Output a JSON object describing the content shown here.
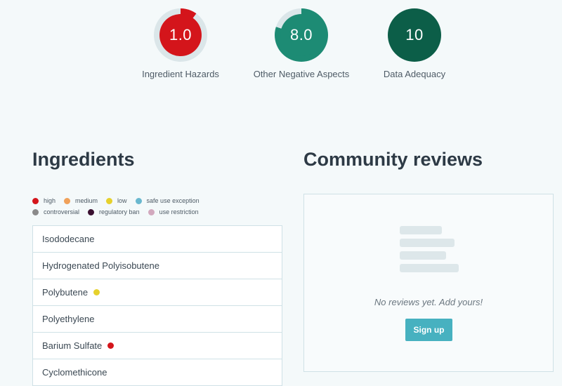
{
  "scores": [
    {
      "value": "1.0",
      "label": "Ingredient Hazards",
      "color": "#d4151b",
      "fill_percent": 10
    },
    {
      "value": "8.0",
      "label": "Other Negative Aspects",
      "color": "#1d8b74",
      "fill_percent": 80
    },
    {
      "value": "10",
      "label": "Data Adequacy",
      "color": "#0c5e48",
      "fill_percent": 100
    }
  ],
  "ingredients": {
    "title": "Ingredients",
    "legend": [
      {
        "label": "high",
        "color": "#d4151b"
      },
      {
        "label": "medium",
        "color": "#f0a15a"
      },
      {
        "label": "low",
        "color": "#e6d12c"
      },
      {
        "label": "safe use exception",
        "color": "#6ab8cf"
      },
      {
        "label": "controversial",
        "color": "#8a8a8a"
      },
      {
        "label": "regulatory ban",
        "color": "#3a1030"
      },
      {
        "label": "use restriction",
        "color": "#d2a9be"
      }
    ],
    "items": [
      {
        "name": "Isododecane",
        "hazard_color": null
      },
      {
        "name": "Hydrogenated Polyisobutene",
        "hazard_color": null
      },
      {
        "name": "Polybutene",
        "hazard_color": "#e6d12c"
      },
      {
        "name": "Polyethylene",
        "hazard_color": null
      },
      {
        "name": "Barium Sulfate",
        "hazard_color": "#d4151b"
      },
      {
        "name": "Cyclomethicone",
        "hazard_color": null
      }
    ]
  },
  "reviews": {
    "title": "Community reviews",
    "empty_text": "No reviews yet. Add yours!",
    "signup_label": "Sign up"
  }
}
